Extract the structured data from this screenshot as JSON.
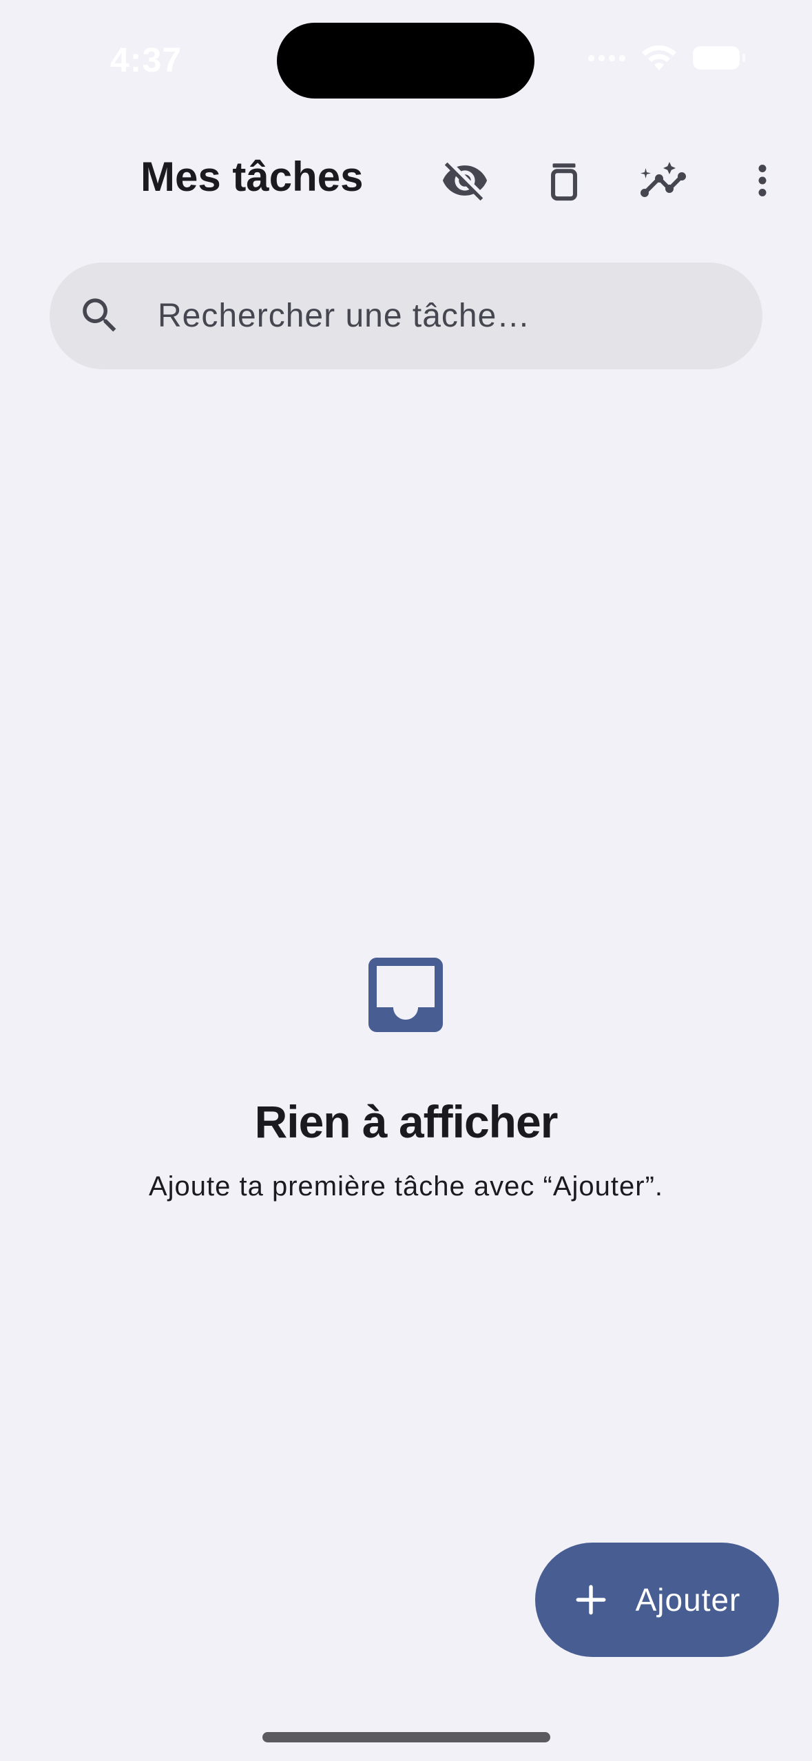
{
  "status_bar": {
    "time": "4:37"
  },
  "app_bar": {
    "title": "Mes tâches",
    "actions": [
      {
        "icon": "visibility-off-icon"
      },
      {
        "icon": "delete-icon"
      },
      {
        "icon": "insights-icon"
      },
      {
        "icon": "more-vertical-icon"
      }
    ]
  },
  "search": {
    "placeholder": "Rechercher une tâche…",
    "value": ""
  },
  "empty_state": {
    "icon": "inbox-icon",
    "title": "Rien à afficher",
    "subtitle": "Ajoute ta première tâche avec “Ajouter”."
  },
  "fab": {
    "label": "Ajouter",
    "icon": "plus-icon"
  },
  "colors": {
    "background": "#f2f1f8",
    "accent": "#485e92",
    "search_fill": "#e3e3e8",
    "icon": "#45464f"
  }
}
